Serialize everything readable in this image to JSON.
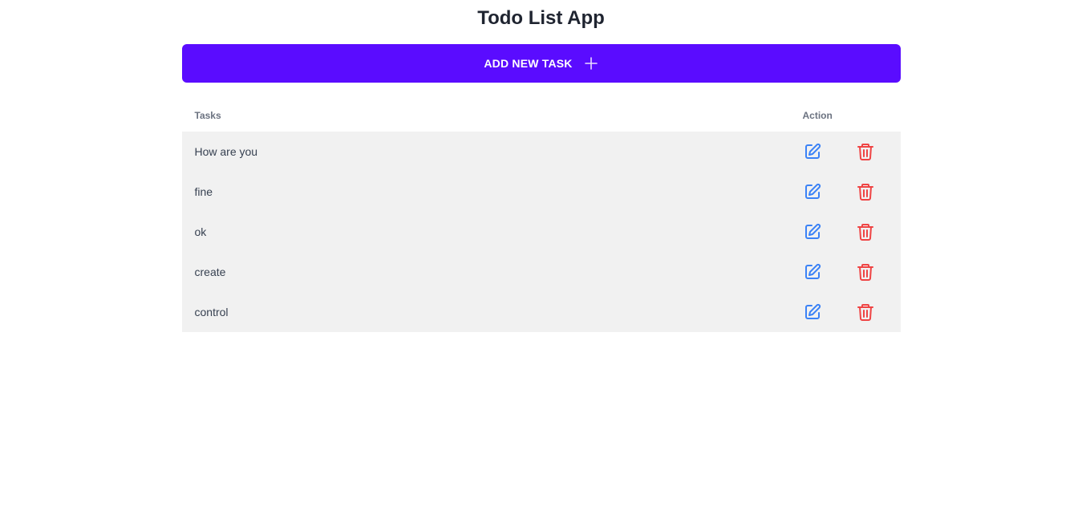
{
  "app": {
    "title": "Todo List App"
  },
  "toolbar": {
    "add_label": "ADD NEW TASK",
    "add_icon": "plus-icon",
    "accent_color": "#5a0cff"
  },
  "table": {
    "headers": {
      "tasks": "Tasks",
      "action": "Action"
    },
    "rows": [
      {
        "task": "How are you"
      },
      {
        "task": "fine"
      },
      {
        "task": "ok"
      },
      {
        "task": "create"
      },
      {
        "task": "control"
      }
    ],
    "edit_icon": "edit-icon",
    "delete_icon": "trash-icon",
    "edit_color": "#3b82f6",
    "delete_color": "#ef4444",
    "row_background": "#f1f1f1"
  }
}
